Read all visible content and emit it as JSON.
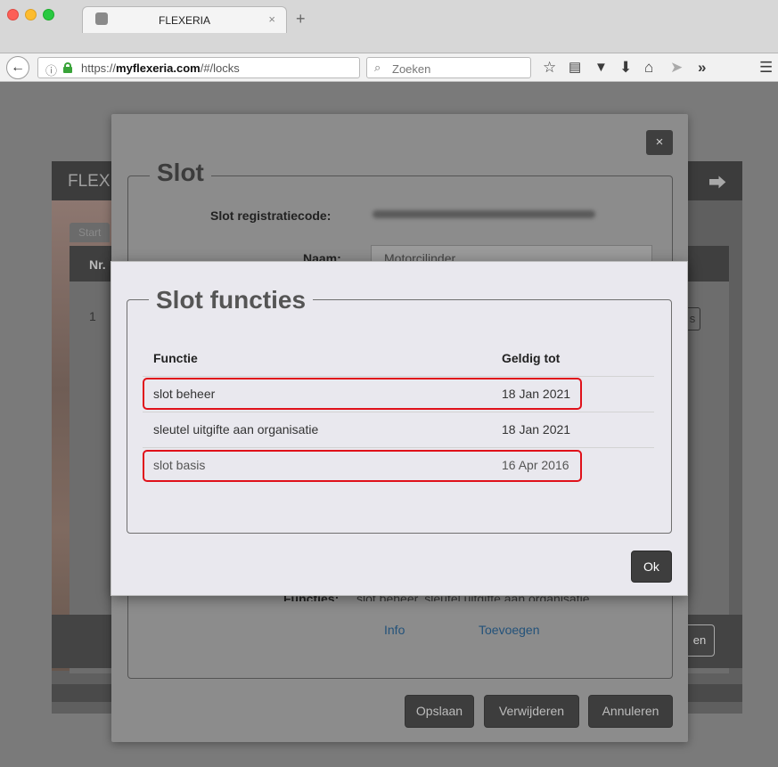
{
  "browser": {
    "tab_title": "FLEXERIA",
    "tab_close": "×",
    "new_tab": "+",
    "url_prefix": "https://",
    "url_domain": "myflexeria.com",
    "url_path": "/#/locks",
    "search_placeholder": "Zoeken",
    "toolbar_more": "»"
  },
  "background_page": {
    "brand": "FLEX",
    "tab_start": "Start",
    "table_header_nr": "Nr.",
    "row_number": "1",
    "row_button_fragment": "s",
    "footer_button_fragment": "en"
  },
  "slot_dialog": {
    "close_symbol": "×",
    "legend": "Slot",
    "registration_label": "Slot registratiecode:",
    "name_label": "Naam:",
    "name_value": "Motorcilinder",
    "functions_label": "Functies:",
    "functions_value": "slot beheer, sleutel uitgifte aan organisatie,",
    "info_link": "Info",
    "add_link": "Toevoegen",
    "save_button": "Opslaan",
    "delete_button": "Verwijderen",
    "cancel_button": "Annuleren"
  },
  "functions_dialog": {
    "legend": "Slot functies",
    "columns": {
      "function": "Functie",
      "valid_until": "Geldig tot"
    },
    "rows": [
      {
        "name": "slot beheer",
        "date": "18 Jan 2021",
        "highlighted": true
      },
      {
        "name": "sleutel uitgifte aan organisatie",
        "date": "18 Jan 2021",
        "highlighted": false
      },
      {
        "name": "slot basis",
        "date": "16 Apr 2016",
        "highlighted": true
      }
    ],
    "ok_button": "Ok",
    "highlight_color": "#e0111a"
  }
}
